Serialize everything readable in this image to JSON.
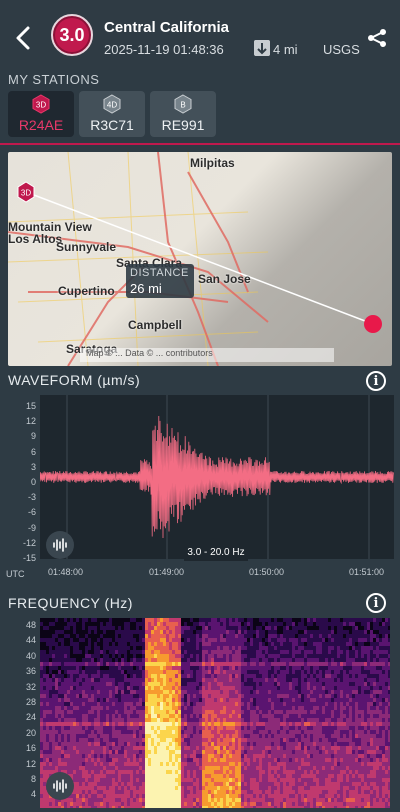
{
  "header": {
    "magnitude": "3.0",
    "title": "Central California",
    "datetime": "2025-11-19 01:48:36",
    "distance": "4 mi",
    "source": "USGS"
  },
  "stations": {
    "label": "MY STATIONS",
    "items": [
      {
        "badge": "3D",
        "code": "R24AE",
        "active": true
      },
      {
        "badge": "4D",
        "code": "R3C71",
        "active": false
      },
      {
        "badge": "B",
        "code": "RE991",
        "active": false
      }
    ]
  },
  "map": {
    "station_badge": "3D",
    "towns": [
      "Milpitas",
      "Mountain View",
      "Los Altos",
      "Sunnyvale",
      "Santa Clara",
      "San Jose",
      "Cupertino",
      "Campbell",
      "Saratoga"
    ],
    "distance_label": "DISTANCE",
    "distance_value": "26 mi",
    "attribution": "Map © ... Data © ... contributors"
  },
  "waveform": {
    "title": "WAVEFORM (µm/s)",
    "y_ticks": [
      "15",
      "12",
      "9",
      "6",
      "3",
      "0",
      "-3",
      "-6",
      "-9",
      "-12",
      "-15"
    ],
    "x_label": "UTC",
    "x_ticks": [
      "01:48:00",
      "01:49:00",
      "01:50:00",
      "01:51:00"
    ],
    "filter": "3.0 - 20.0 Hz",
    "color": "#f36d84"
  },
  "frequency": {
    "title": "FREQUENCY (Hz)",
    "y_ticks": [
      "48",
      "44",
      "40",
      "36",
      "32",
      "28",
      "24",
      "20",
      "16",
      "12",
      "8",
      "4"
    ]
  },
  "colors": {
    "accent": "#c0194d",
    "background": "#2e3b44",
    "wave": "#f36d84"
  }
}
